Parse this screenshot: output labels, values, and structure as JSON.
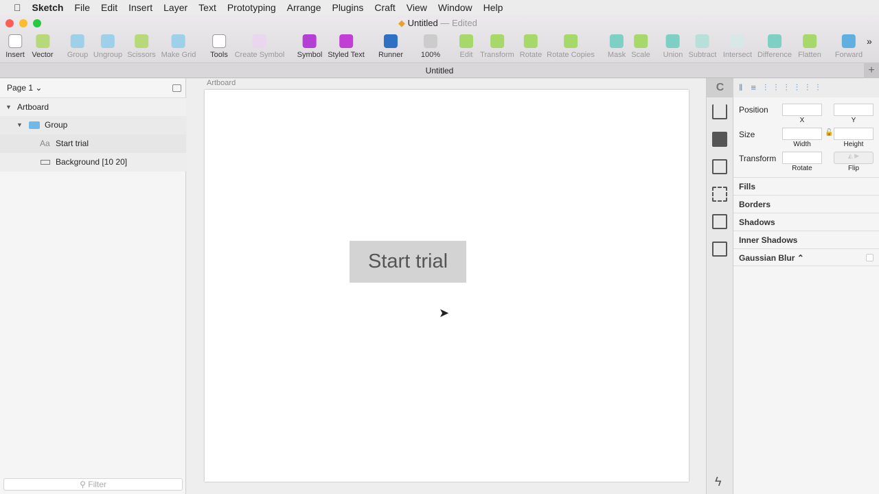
{
  "menubar": {
    "items": [
      "Sketch",
      "File",
      "Edit",
      "Insert",
      "Layer",
      "Text",
      "Prototyping",
      "Arrange",
      "Plugins",
      "Craft",
      "View",
      "Window",
      "Help"
    ]
  },
  "window": {
    "title": "Untitled",
    "edited": "— Edited",
    "tab": "Untitled"
  },
  "toolbar": [
    {
      "label": "Insert",
      "color": "#ffffff",
      "disabled": false
    },
    {
      "label": "Vector",
      "color": "#b8d97a",
      "disabled": false
    },
    {
      "label": "Group",
      "color": "#9fd0ea",
      "disabled": true
    },
    {
      "label": "Ungroup",
      "color": "#9fd0ea",
      "disabled": true
    },
    {
      "label": "Scissors",
      "color": "#b8d97a",
      "disabled": true
    },
    {
      "label": "Make Grid",
      "color": "#9fd0ea",
      "disabled": true
    },
    {
      "label": "Tools",
      "color": "#ffffff",
      "disabled": false
    },
    {
      "label": "Create Symbol",
      "color": "#ead6ee",
      "disabled": true
    },
    {
      "label": "Symbol",
      "color": "#b33fd4",
      "disabled": false
    },
    {
      "label": "Styled Text",
      "color": "#c23fd6",
      "disabled": false
    },
    {
      "label": "Runner",
      "color": "#2f6fc4",
      "disabled": false
    },
    {
      "label": "100%",
      "color": "#cccccc",
      "disabled": false
    },
    {
      "label": "Edit",
      "color": "#a6d86a",
      "disabled": true
    },
    {
      "label": "Transform",
      "color": "#a6d86a",
      "disabled": true
    },
    {
      "label": "Rotate",
      "color": "#a6d86a",
      "disabled": true
    },
    {
      "label": "Rotate Copies",
      "color": "#a6d86a",
      "disabled": true
    },
    {
      "label": "Mask",
      "color": "#7fd0c4",
      "disabled": true
    },
    {
      "label": "Scale",
      "color": "#a6d86a",
      "disabled": true
    },
    {
      "label": "Union",
      "color": "#7fd0c4",
      "disabled": true
    },
    {
      "label": "Subtract",
      "color": "#b8e0da",
      "disabled": true
    },
    {
      "label": "Intersect",
      "color": "#d8e8e6",
      "disabled": true
    },
    {
      "label": "Difference",
      "color": "#7fd0c4",
      "disabled": true
    },
    {
      "label": "Flatten",
      "color": "#a6d86a",
      "disabled": true
    },
    {
      "label": "Forward",
      "color": "#5fb0e0",
      "disabled": true
    }
  ],
  "layers": {
    "page": "Page 1 ⌄",
    "items": [
      {
        "name": "Artboard",
        "icon": "triangle-down-icon"
      },
      {
        "name": "Group",
        "icon": "folder-icon"
      },
      {
        "name": "Start trial",
        "icon": "text-icon",
        "glyph": "Aa"
      },
      {
        "name": "Background [10 20]",
        "icon": "rectangle-icon"
      }
    ],
    "filter_placeholder": "Filter"
  },
  "canvas": {
    "artboard_label": "Artboard",
    "button_text": "Start trial"
  },
  "inspector": {
    "position": "Position",
    "x": "X",
    "y": "Y",
    "size": "Size",
    "width": "Width",
    "height": "Height",
    "transform": "Transform",
    "rotate": "Rotate",
    "flip": "Flip",
    "sections": [
      "Fills",
      "Borders",
      "Shadows",
      "Inner Shadows",
      "Gaussian Blur ⌃"
    ]
  }
}
